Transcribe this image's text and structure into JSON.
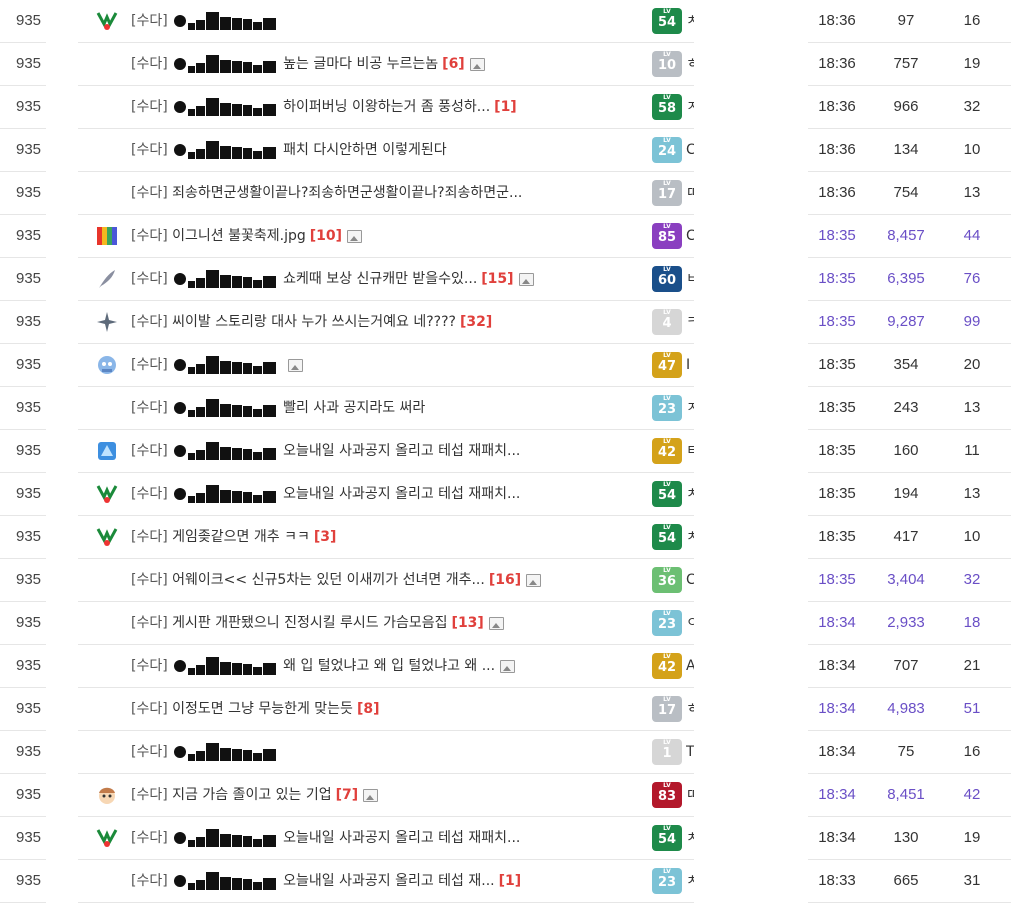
{
  "board": {
    "posts": [
      {
        "no": "935",
        "icon": "green-creature",
        "head": "[수다]",
        "redacted": true,
        "subject": "",
        "count": "",
        "image": false,
        "level": "54",
        "lvcolor": "#1e8a4a",
        "nick": "ㅊ",
        "time": "18:36",
        "views": "97",
        "rec": "16",
        "hot": false
      },
      {
        "no": "935",
        "icon": "",
        "head": "[수다]",
        "redacted": true,
        "subject": "높는 글마다 비공 누르는놈",
        "count": "[6]",
        "image": true,
        "level": "10",
        "lvcolor": "#b9bec4",
        "nick": "ㅎ",
        "time": "18:36",
        "views": "757",
        "rec": "19",
        "hot": false
      },
      {
        "no": "935",
        "icon": "",
        "head": "[수다]",
        "redacted": true,
        "subject": "하이퍼버닝 이왕하는거 좀 풍성하...",
        "count": "[1]",
        "image": false,
        "level": "58",
        "lvcolor": "#1e8a4a",
        "nick": "ㅈ",
        "time": "18:36",
        "views": "966",
        "rec": "32",
        "hot": false
      },
      {
        "no": "935",
        "icon": "",
        "head": "[수다]",
        "redacted": true,
        "subject": "패치 다시안하면 이렇게된다",
        "count": "",
        "image": false,
        "level": "24",
        "lvcolor": "#7cc3d6",
        "nick": "C",
        "time": "18:36",
        "views": "134",
        "rec": "10",
        "hot": false
      },
      {
        "no": "935",
        "icon": "",
        "head": "[수다]",
        "redacted": false,
        "subject": "죄송하면군생활이끝나?죄송하면군생활이끝나?죄송하면군...",
        "count": "",
        "image": false,
        "level": "17",
        "lvcolor": "#b9bec4",
        "nick": "ㄸ",
        "time": "18:36",
        "views": "754",
        "rec": "13",
        "hot": false
      },
      {
        "no": "935",
        "icon": "rainbow",
        "head": "[수다]",
        "redacted": false,
        "subject": "이그니션 불꽃축제.jpg",
        "count": "[10]",
        "image": true,
        "level": "85",
        "lvcolor": "#8a3fc0",
        "nick": "C",
        "time": "18:35",
        "views": "8,457",
        "rec": "44",
        "hot": true
      },
      {
        "no": "935",
        "icon": "quill",
        "head": "[수다]",
        "redacted": true,
        "subject": "쇼케때 보상 신규캐만 받을수있...",
        "count": "[15]",
        "image": true,
        "level": "60",
        "lvcolor": "#1a4f8a",
        "nick": "ㅂ",
        "time": "18:35",
        "views": "6,395",
        "rec": "76",
        "hot": true
      },
      {
        "no": "935",
        "icon": "star",
        "head": "[수다]",
        "redacted": false,
        "subject": "씨이발 스토리랑 대사 누가 쓰시는거예요 네????",
        "count": "[32]",
        "image": false,
        "level": "4",
        "lvcolor": "#d6d6d6",
        "nick": "ㅋ",
        "time": "18:35",
        "views": "9,287",
        "rec": "99",
        "hot": true
      },
      {
        "no": "935",
        "icon": "blue-creature",
        "head": "[수다]",
        "redacted": true,
        "subject": "",
        "count": "",
        "image": true,
        "level": "47",
        "lvcolor": "#d4a21a",
        "nick": "I",
        "time": "18:35",
        "views": "354",
        "rec": "20",
        "hot": false
      },
      {
        "no": "935",
        "icon": "",
        "head": "[수다]",
        "redacted": true,
        "subject": "빨리 사과 공지라도 써라",
        "count": "",
        "image": false,
        "level": "23",
        "lvcolor": "#7cc3d6",
        "nick": "ㅈ",
        "time": "18:35",
        "views": "243",
        "rec": "13",
        "hot": false
      },
      {
        "no": "935",
        "icon": "blue-crystal",
        "head": "[수다]",
        "redacted": true,
        "subject": "오늘내일 사과공지 올리고 테섭 재패치...",
        "count": "",
        "image": false,
        "level": "42",
        "lvcolor": "#d4a21a",
        "nick": "ㅌ",
        "time": "18:35",
        "views": "160",
        "rec": "11",
        "hot": false
      },
      {
        "no": "935",
        "icon": "green-creature",
        "head": "[수다]",
        "redacted": true,
        "subject": "오늘내일 사과공지 올리고 테섭 재패치...",
        "count": "",
        "image": false,
        "level": "54",
        "lvcolor": "#1e8a4a",
        "nick": "ㅊ",
        "time": "18:35",
        "views": "194",
        "rec": "13",
        "hot": false
      },
      {
        "no": "935",
        "icon": "green-creature",
        "head": "[수다]",
        "redacted": false,
        "subject": "게임좆같으면 개추 ㅋㅋ",
        "count": "[3]",
        "image": false,
        "level": "54",
        "lvcolor": "#1e8a4a",
        "nick": "ㅊ",
        "time": "18:35",
        "views": "417",
        "rec": "10",
        "hot": false
      },
      {
        "no": "935",
        "icon": "",
        "head": "[수다]",
        "redacted": false,
        "subject": "어웨이크<< 신규5차는 있던 이새끼가 선녀면 개추...",
        "count": "[16]",
        "image": true,
        "level": "36",
        "lvcolor": "#6cbf73",
        "nick": "C",
        "time": "18:35",
        "views": "3,404",
        "rec": "32",
        "hot": true
      },
      {
        "no": "935",
        "icon": "",
        "head": "[수다]",
        "redacted": false,
        "subject": "게시판 개판됐으니 진정시킬 루시드 가슴모음집",
        "count": "[13]",
        "image": true,
        "level": "23",
        "lvcolor": "#7cc3d6",
        "nick": "ㅇ",
        "time": "18:34",
        "views": "2,933",
        "rec": "18",
        "hot": true
      },
      {
        "no": "935",
        "icon": "",
        "head": "[수다]",
        "redacted": true,
        "subject": "왜 입 털었냐고 왜 입 털었냐고 왜 ...",
        "count": "",
        "image": true,
        "level": "42",
        "lvcolor": "#d4a21a",
        "nick": "A",
        "time": "18:34",
        "views": "707",
        "rec": "21",
        "hot": false
      },
      {
        "no": "935",
        "icon": "",
        "head": "[수다]",
        "redacted": false,
        "subject": "이정도면 그냥 무능한게 맞는듯",
        "count": "[8]",
        "image": false,
        "level": "17",
        "lvcolor": "#b9bec4",
        "nick": "ㅎ",
        "time": "18:34",
        "views": "4,983",
        "rec": "51",
        "hot": true
      },
      {
        "no": "935",
        "icon": "",
        "head": "[수다]",
        "redacted": true,
        "subject": "",
        "count": "",
        "image": false,
        "level": "1",
        "lvcolor": "#d6d6d6",
        "nick": "T",
        "time": "18:34",
        "views": "75",
        "rec": "16",
        "hot": false
      },
      {
        "no": "935",
        "icon": "pink-character",
        "head": "[수다]",
        "redacted": false,
        "subject": "지금 가슴 졸이고 있는 기업",
        "count": "[7]",
        "image": true,
        "level": "83",
        "lvcolor": "#b3182b",
        "nick": "ㄸ",
        "time": "18:34",
        "views": "8,451",
        "rec": "42",
        "hot": true
      },
      {
        "no": "935",
        "icon": "green-creature",
        "head": "[수다]",
        "redacted": true,
        "subject": "오늘내일 사과공지 올리고 테섭 재패치...",
        "count": "",
        "image": false,
        "level": "54",
        "lvcolor": "#1e8a4a",
        "nick": "ㅊ",
        "time": "18:34",
        "views": "130",
        "rec": "19",
        "hot": false
      },
      {
        "no": "935",
        "icon": "",
        "head": "[수다]",
        "redacted": true,
        "subject": "오늘내일 사과공지 올리고 테섭 재...",
        "count": "[1]",
        "image": false,
        "level": "23",
        "lvcolor": "#7cc3d6",
        "nick": "ㅊ",
        "time": "18:33",
        "views": "665",
        "rec": "31",
        "hot": false
      }
    ]
  }
}
